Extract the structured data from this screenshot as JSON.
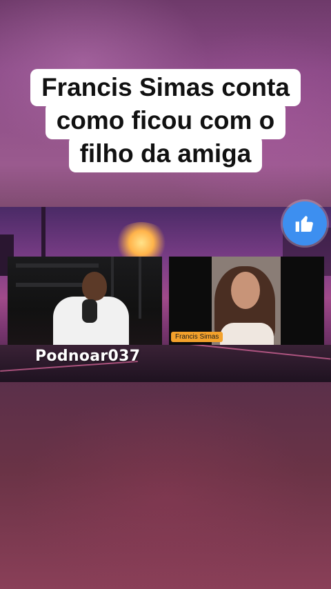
{
  "caption": {
    "lines": [
      "Francis Simas conta",
      "como ficou com o",
      "filho da amiga"
    ]
  },
  "video": {
    "channel_name": "Podnoar037",
    "guest_name_tag": "Francis Simas"
  },
  "like_button": {
    "icon": "thumbs-up-icon",
    "color": "#3d8ff0"
  }
}
